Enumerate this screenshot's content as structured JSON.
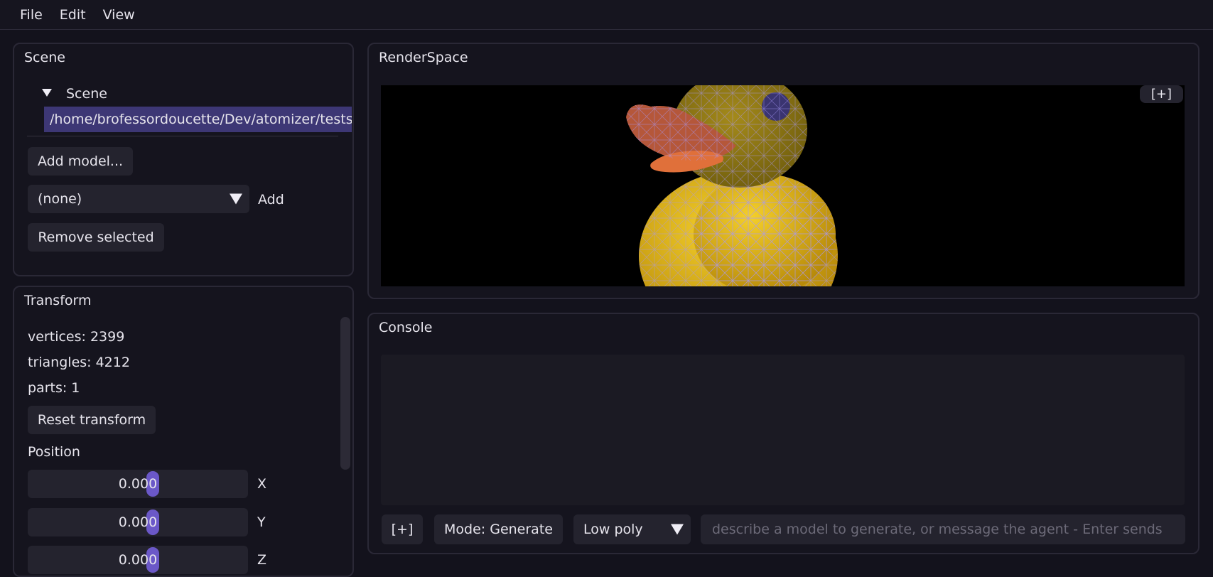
{
  "menubar": {
    "items": [
      "File",
      "Edit",
      "View"
    ]
  },
  "scene_panel": {
    "title": "Scene",
    "tree_root": "Scene",
    "tree_item": "/home/brofessordoucette/Dev/atomizer/tests",
    "add_model_label": "Add model...",
    "combo_value": "(none)",
    "add_label": "Add",
    "remove_label": "Remove selected"
  },
  "transform_panel": {
    "title": "Transform",
    "vertices": "vertices: 2399",
    "triangles": "triangles: 4212",
    "parts": "parts: 1",
    "reset_label": "Reset transform",
    "position_label": "Position",
    "sliders": [
      {
        "value": "0.000",
        "axis": "X"
      },
      {
        "value": "0.000",
        "axis": "Y"
      },
      {
        "value": "0.000",
        "axis": "Z"
      }
    ]
  },
  "render_panel": {
    "title": "RenderSpace",
    "expand_label": "[+]"
  },
  "console_panel": {
    "title": "Console",
    "expand_label": "[+]",
    "mode_label": "Mode: Generate",
    "quality_value": "Low poly",
    "input_placeholder": "describe a model to generate, or message the agent - Enter sends"
  },
  "colors": {
    "background": "#13121c",
    "panel": "#15141e",
    "button": "#24232e",
    "selection": "#3d3775",
    "slider_grab": "#6b58c8",
    "duck_body": "#e0b417",
    "duck_beak": "#e06a36",
    "wireframe": "#9a8cf0"
  }
}
